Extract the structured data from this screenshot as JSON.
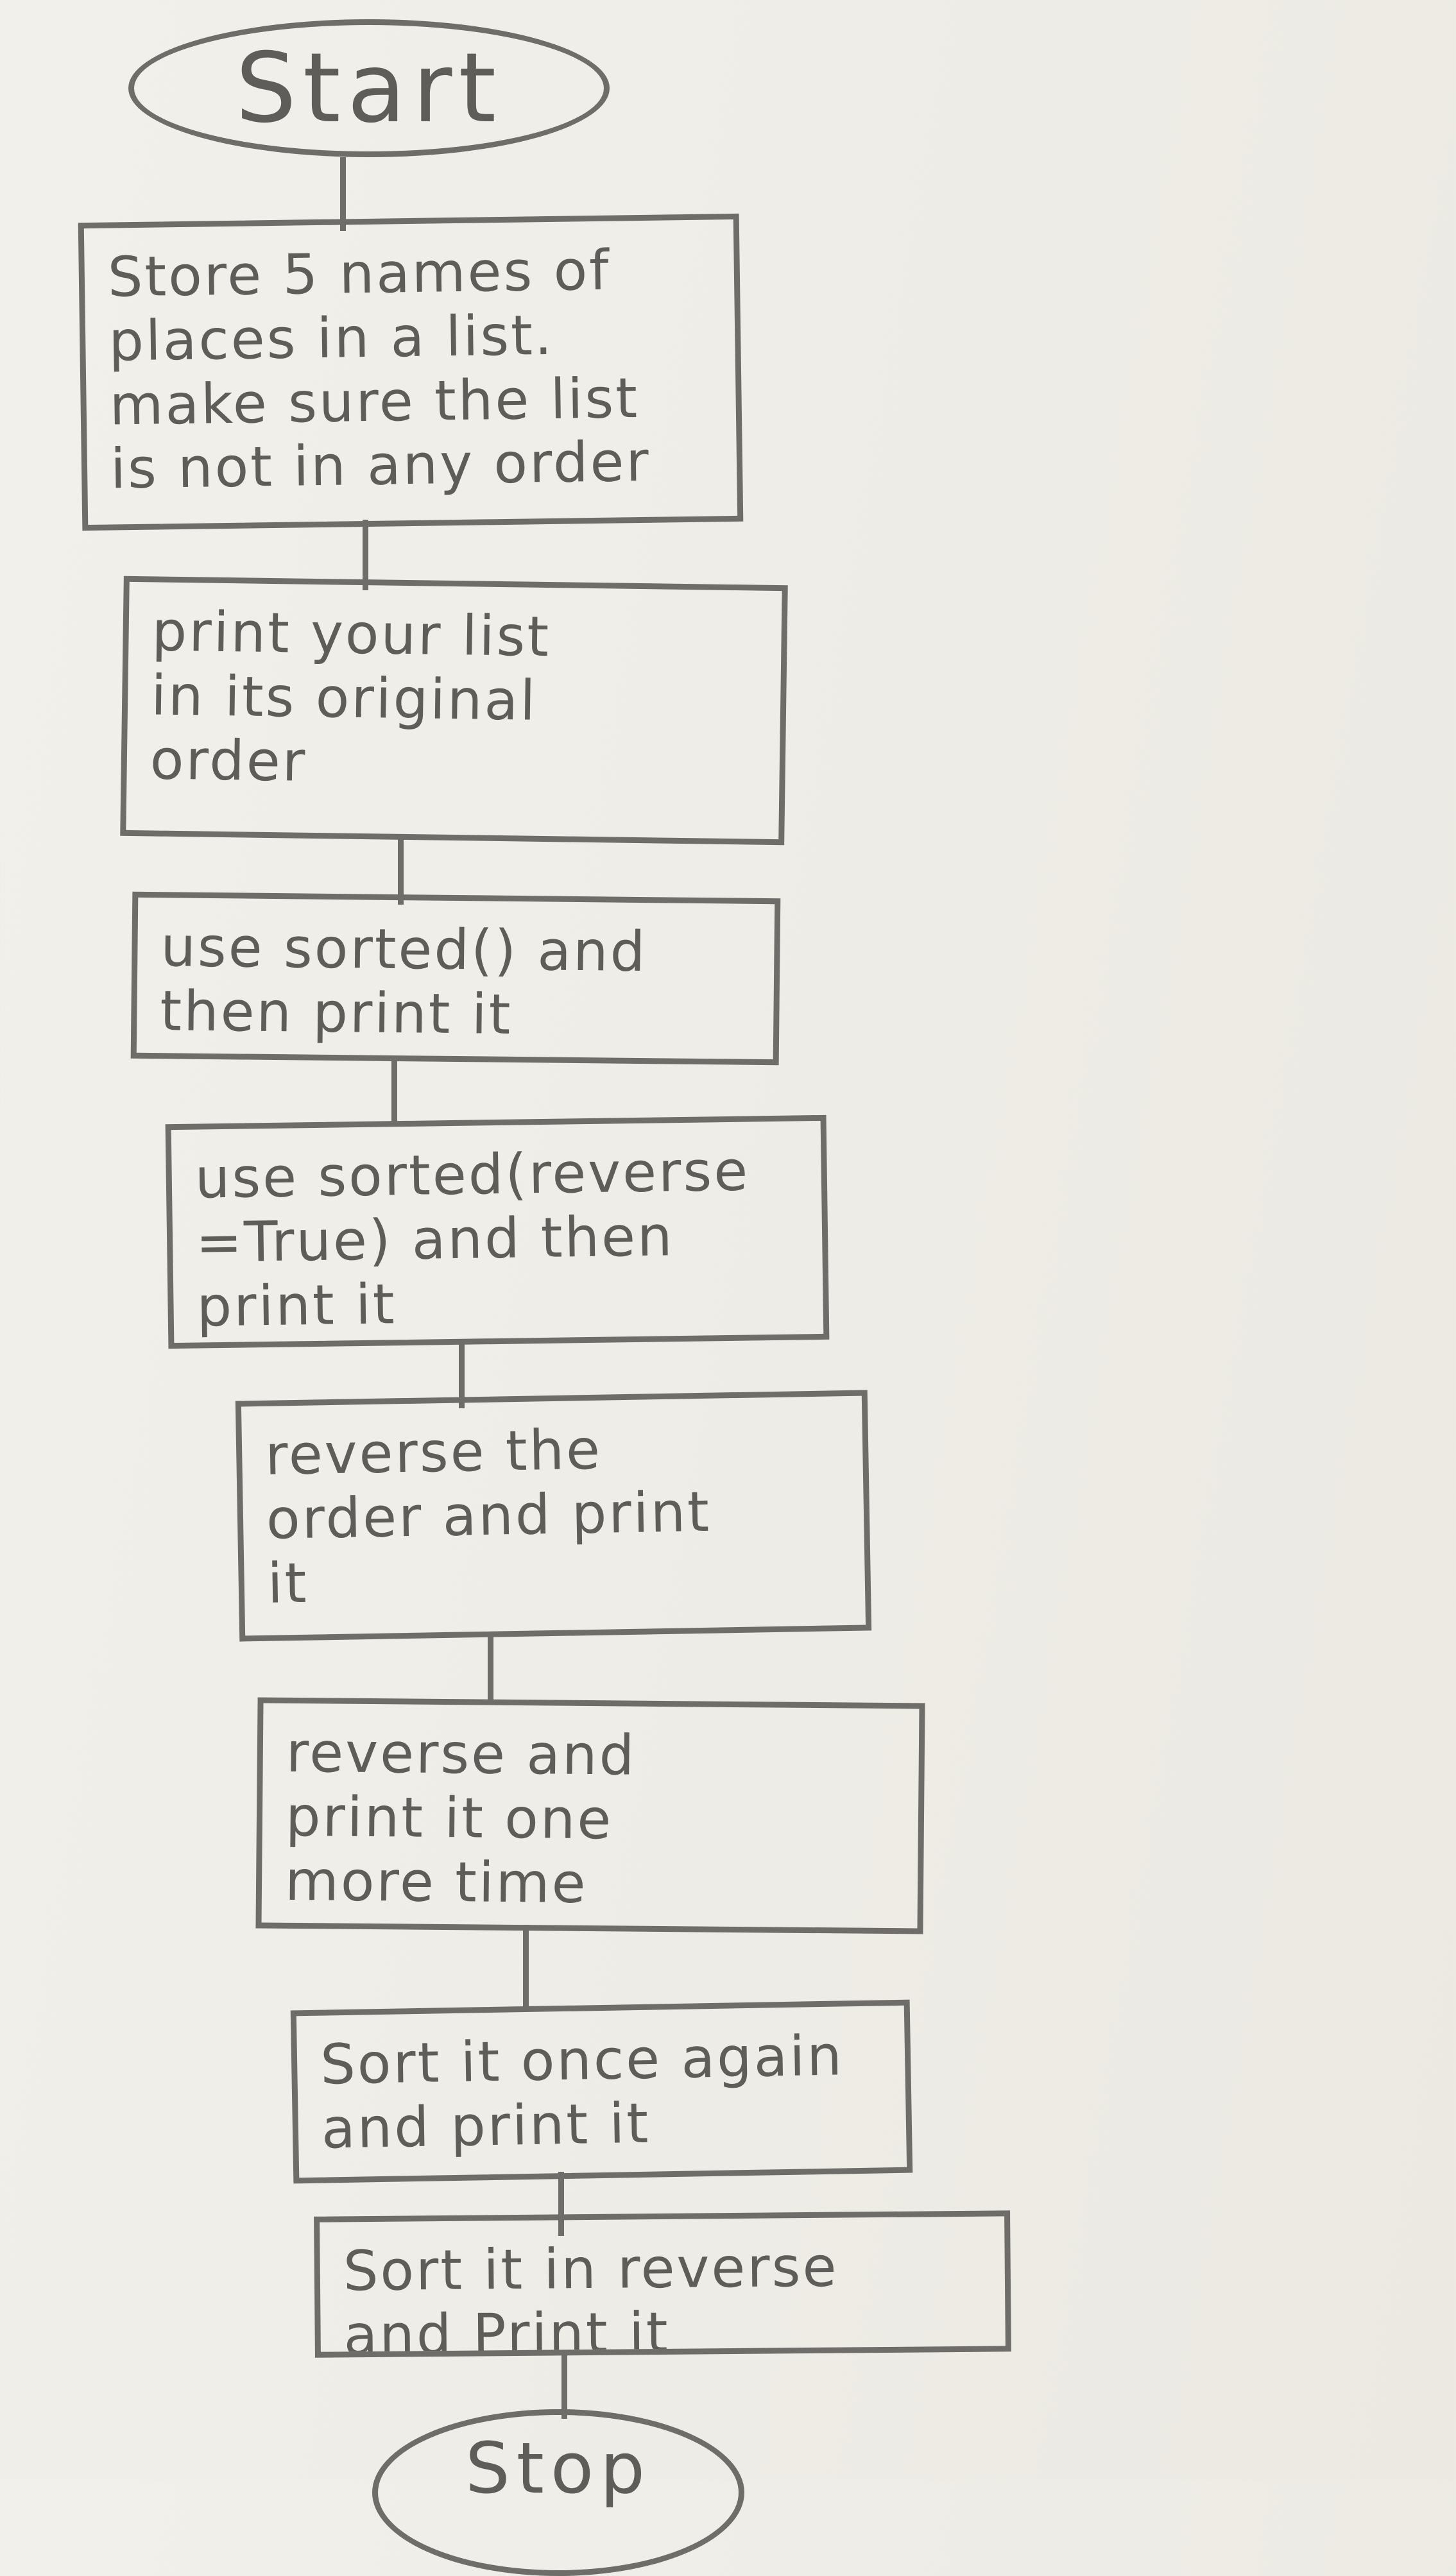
{
  "flowchart": {
    "start": "Start",
    "steps": [
      "Store 5 names of\nplaces in a list.\nmake sure the list\nis not in any order",
      "print your list\nin its original\norder",
      "use sorted() and\nthen print it",
      "use sorted(reverse\n=True) and then\nprint it",
      "reverse the\norder and print\nit",
      "reverse and\nprint it one\nmore time",
      "Sort it once again\nand print it",
      "Sort it in reverse\nand Print it"
    ],
    "stop": "Stop"
  },
  "colors": {
    "paper": "#efede7",
    "pencil": "#6f6d69"
  }
}
